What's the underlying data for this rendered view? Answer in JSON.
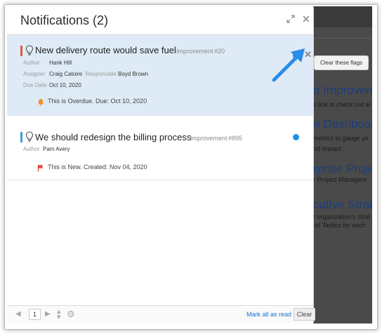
{
  "panel": {
    "title": "Notifications (2)"
  },
  "notifications": [
    {
      "title": "New delivery route would save fuel",
      "type": "Improvement",
      "number": "#20",
      "type_color": "#e05a3a",
      "author_label": "Author",
      "author": "Hank Hill",
      "assigner_label": "Assigner",
      "assigner": "Craig Catoire",
      "responsible_label": "Responsible",
      "responsible": "Boyd Brown",
      "due_label": "Due Date",
      "due": "Oct 10, 2020",
      "status_text": "This is Overdue. Due: Oct 10, 2020",
      "status_icon": "bell-icon",
      "status_color": "#f0902a"
    },
    {
      "title": "We should redesign the billing process",
      "type": "Improvement",
      "number": "#895",
      "type_color": "#3aa0e0",
      "author_label": "Author",
      "author": "Pam Avery",
      "status_text": "This is New. Created: Nov 04, 2020",
      "status_icon": "flag-icon",
      "status_color": "#e04848"
    }
  ],
  "tooltip": {
    "text": "Clear these flags"
  },
  "footer": {
    "page": "1",
    "mark_all_read": "Mark all as read",
    "clear": "Clear"
  },
  "background_page": {
    "headings": [
      "n Improvem",
      "n Dashboard",
      "rprise Proje",
      "cutive Strate"
    ],
    "body_lines": [
      "s link to check out al",
      "metrics to gauge yo",
      "nd Impact.",
      "r Project Managem",
      "r organization's strat",
      "nd Tactics for each"
    ]
  },
  "colors": {
    "accent": "#1e90e8",
    "selected_bg": "#deebf7",
    "link": "#1a73c6"
  }
}
